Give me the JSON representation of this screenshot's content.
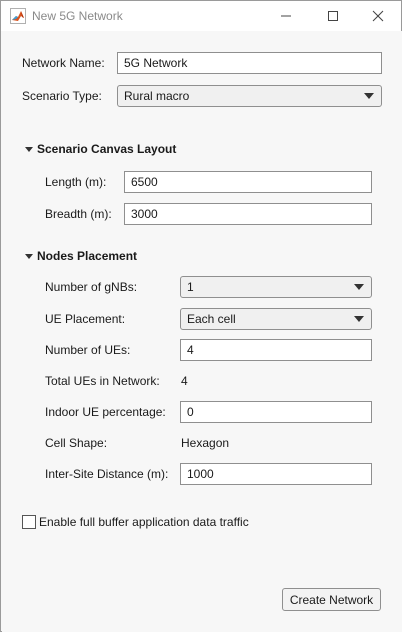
{
  "window": {
    "title": "New 5G Network",
    "icon": "matlab-logo-icon",
    "controls": [
      "minimize-icon",
      "maximize-icon",
      "close-icon"
    ]
  },
  "network": {
    "name_label": "Network Name:",
    "name_value": "5G Network",
    "scenario_label": "Scenario Type:",
    "scenario_value": "Rural macro"
  },
  "canvas_layout": {
    "heading": "Scenario Canvas Layout",
    "length_label": "Length (m):",
    "length_value": "6500",
    "breadth_label": "Breadth (m):",
    "breadth_value": "3000"
  },
  "nodes": {
    "heading": "Nodes Placement",
    "gnbs_label": "Number of gNBs:",
    "gnbs_value": "1",
    "ue_placement_label": "UE Placement:",
    "ue_placement_value": "Each cell",
    "num_ues_label": "Number of UEs:",
    "num_ues_value": "4",
    "total_ues_label": "Total UEs in Network:",
    "total_ues_value": "4",
    "indoor_label": "Indoor UE percentage:",
    "indoor_value": "0",
    "cell_shape_label": "Cell Shape:",
    "cell_shape_value": "Hexagon",
    "isd_label": "Inter-Site Distance (m):",
    "isd_value": "1000"
  },
  "traffic": {
    "checkbox_label": "Enable full buffer application data traffic",
    "checked": false
  },
  "actions": {
    "create_label": "Create Network"
  },
  "colors": {
    "window_bg": "#f7f7f7",
    "field_border": "#8f8f8f",
    "title_text": "#8a8a8a"
  }
}
